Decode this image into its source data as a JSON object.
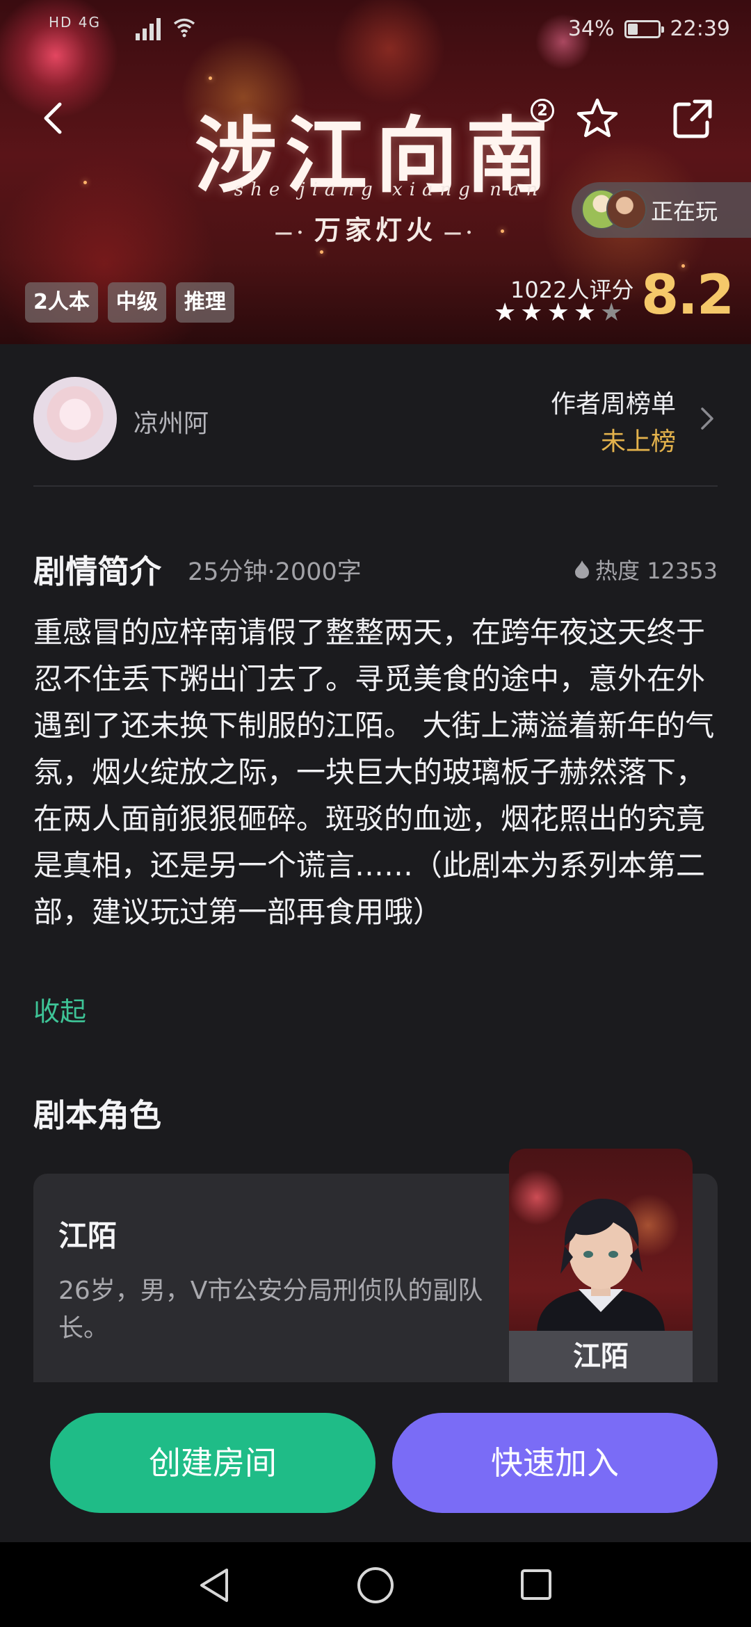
{
  "status_bar": {
    "network_left": "HD 4G",
    "battery_percent": "34%",
    "battery_level": 0.34,
    "time": "22:39"
  },
  "header": {
    "title": "涉江向南",
    "title_superscript": "2",
    "title_pinyin": "she jiang xiang nan",
    "subtitle": "万家灯火",
    "playing_label": "正在玩",
    "tags": [
      "2人本",
      "中级",
      "推理"
    ],
    "rating_count": "1022人评分",
    "rating_score": "8.2",
    "rating_stars_filled": 4,
    "rating_stars_total": 5,
    "icons": {
      "back": "chevron-left-icon",
      "favorite": "star-outline-icon",
      "share": "share-icon"
    }
  },
  "author": {
    "name": "凉州阿",
    "rank_title": "作者周榜单",
    "rank_value": "未上榜"
  },
  "synopsis": {
    "title": "剧情简介",
    "meta": "25分钟·2000字",
    "heat": "热度 12353",
    "text": "重感冒的应梓南请假了整整两天，在跨年夜这天终于忍不住丢下粥出门去了。寻觅美食的途中，意外在外遇到了还未换下制服的江陌。 大街上满溢着新年的气氛，烟火绽放之际，一块巨大的玻璃板子赫然落下，在两人面前狠狠砸碎。斑驳的血迹，烟花照出的究竟是真相，还是另一个谎言……（此剧本为系列本第二部，建议玩过第一部再食用哦）",
    "collapse_label": "收起"
  },
  "roles": {
    "title": "剧本角色",
    "items": [
      {
        "name": "江陌",
        "description": "26岁，男，V市公安分局刑侦队的副队长。",
        "portrait_label": "江陌"
      }
    ]
  },
  "actions": {
    "create_room": "创建房间",
    "quick_join": "快速加入"
  },
  "colors": {
    "accent_green": "#1fbc87",
    "accent_purple": "#7a6cf6",
    "rating_gold": "#f5c86a",
    "rank_gold": "#e3b24c",
    "link_green": "#3ec497"
  }
}
